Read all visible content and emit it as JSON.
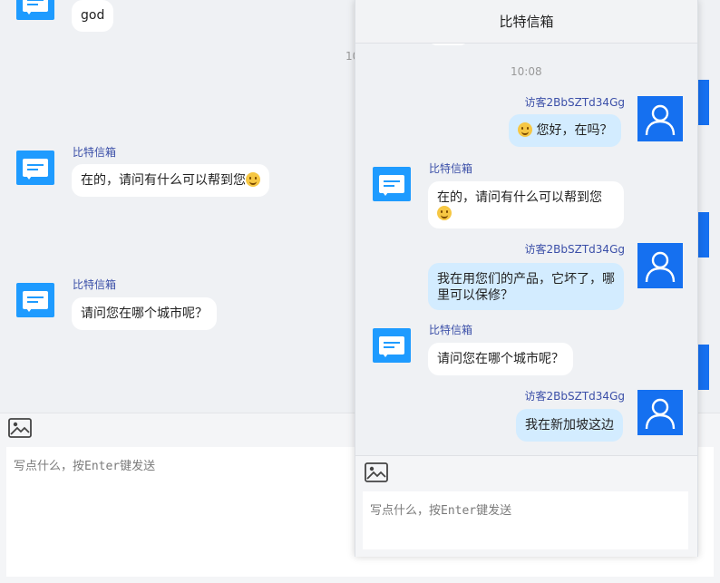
{
  "background_chat": {
    "messages": [
      {
        "text": "god"
      },
      {
        "time": "10"
      },
      {
        "sender": "比特信箱",
        "text": "在的，请问有什么可以帮到您"
      },
      {
        "sender": "比特信箱",
        "text": "请问您在哪个城市呢？"
      }
    ],
    "compose": {
      "placeholder": "写点什么，按Enter键发送"
    }
  },
  "panel": {
    "title": "比特信箱",
    "time": "10:08",
    "messages": [
      {
        "from": "visitor",
        "sender": "访客2BbSZTd34Gg",
        "text": "您好，在吗？"
      },
      {
        "from": "bot",
        "sender": "比特信箱",
        "text": "在的，请问有什么可以帮到您"
      },
      {
        "from": "visitor",
        "sender": "访客2BbSZTd34Gg",
        "text": "我在用您们的产品，它坏了，哪里可以保修？"
      },
      {
        "from": "bot",
        "sender": "比特信箱",
        "text": "请问您在哪个城市呢？"
      },
      {
        "from": "visitor",
        "sender": "访客2BbSZTd34Gg",
        "text": "我在新加坡这边"
      }
    ],
    "compose": {
      "placeholder": "写点什么，按Enter键发送"
    }
  },
  "icons": {
    "bot_avatar": "chat-document-icon",
    "user_avatar": "user-icon",
    "image": "image-icon",
    "emoji": "smiley-emoji-icon"
  },
  "colors": {
    "accent": "#1e9bff",
    "user_avatar": "#1570f0",
    "visitor_bubble": "#d3ecff",
    "sender_name": "#3b4fa8"
  }
}
